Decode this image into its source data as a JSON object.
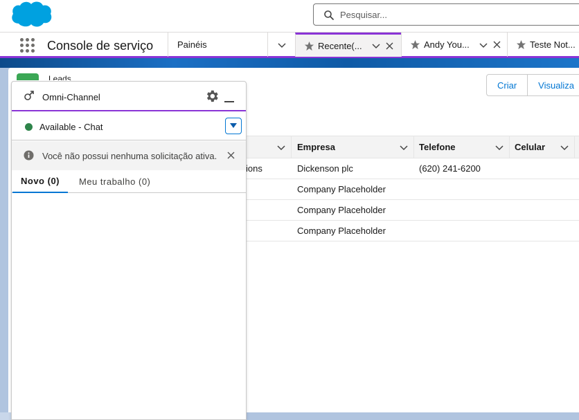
{
  "header": {
    "search_placeholder": "Pesquisar..."
  },
  "nav": {
    "app_name": "Console de serviço",
    "tabs": [
      {
        "label": "Painéis"
      },
      {
        "label": "Recente(..."
      },
      {
        "label": "Andy You..."
      },
      {
        "label": "Teste Not..."
      }
    ]
  },
  "list": {
    "object_label": "Leads",
    "buttons": {
      "create": "Criar",
      "view": "Visualiza"
    },
    "columns": [
      "Empresa",
      "Telefone",
      "Celular"
    ],
    "rows": [
      {
        "fragment": "ions",
        "empresa": "Dickenson plc",
        "telefone": "(620) 241-6200"
      },
      {
        "fragment": "",
        "empresa": "Company Placeholder",
        "telefone": ""
      },
      {
        "fragment": "",
        "empresa": "Company Placeholder",
        "telefone": ""
      },
      {
        "fragment": "",
        "empresa": "Company Placeholder",
        "telefone": ""
      }
    ]
  },
  "omni": {
    "title": "Omni-Channel",
    "status": "Available - Chat",
    "status_color": "#2e844a",
    "notice": "Você não possui nenhuma solicitação ativa.",
    "tabs": {
      "new": "Novo (0)",
      "my_work": "Meu trabalho (0)"
    }
  },
  "colors": {
    "accent": "#8a33d6",
    "brand": "#0176d3",
    "lead_icon": "#3ba755"
  }
}
